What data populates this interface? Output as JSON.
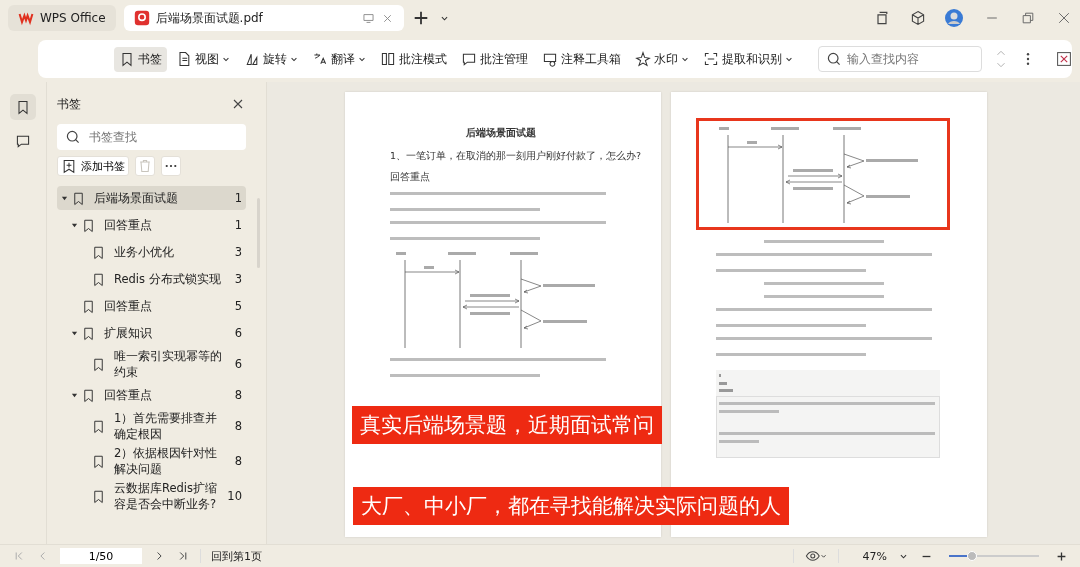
{
  "tabs": [
    {
      "label": "WPS Office",
      "selected": false
    },
    {
      "label": "后端场景面试题.pdf",
      "selected": true
    }
  ],
  "toolbar": {
    "buttons": [
      {
        "label": "书签",
        "selected": true,
        "dropdown": false
      },
      {
        "label": "视图",
        "selected": false,
        "dropdown": true
      },
      {
        "label": "旋转",
        "selected": false,
        "dropdown": true
      },
      {
        "label": "翻译",
        "selected": false,
        "dropdown": true
      },
      {
        "label": "批注模式",
        "selected": false,
        "dropdown": false
      },
      {
        "label": "批注管理",
        "selected": false,
        "dropdown": false
      },
      {
        "label": "注释工具箱",
        "selected": false,
        "dropdown": false
      },
      {
        "label": "水印",
        "selected": false,
        "dropdown": true
      },
      {
        "label": "提取和识别",
        "selected": false,
        "dropdown": true
      }
    ],
    "search": {
      "placeholder": "输入查找内容"
    }
  },
  "rail": [
    {
      "selected": true
    },
    {
      "selected": false
    }
  ],
  "bookmarks": {
    "title": "书签",
    "search": {
      "placeholder": "书签查找"
    },
    "add_button": "添加书签",
    "delete_disabled": true,
    "items": [
      {
        "label": "后端场景面试题",
        "page": "1",
        "selected": true,
        "expanded": true,
        "children": [
          {
            "label": "回答重点",
            "page": "1",
            "selected": false,
            "expanded": true,
            "children": [
              {
                "label": "业务小优化",
                "page": "3",
                "selected": false
              },
              {
                "label": "Redis 分布式锁实现",
                "page": "3",
                "selected": false
              }
            ]
          },
          {
            "label": "回答重点",
            "page": "5",
            "selected": false
          },
          {
            "label": "扩展知识",
            "page": "6",
            "selected": false,
            "expanded": true,
            "children": [
              {
                "label": "唯一索引实现幂等的约束",
                "page": "6",
                "selected": false
              }
            ]
          },
          {
            "label": "回答重点",
            "page": "8",
            "selected": false,
            "expanded": true,
            "children": [
              {
                "label": "1）首先需要排查并确定根因",
                "page": "8",
                "selected": false
              },
              {
                "label": "2）依据根因针对性解决问题",
                "page": "8",
                "selected": false
              },
              {
                "label": "云数据库Redis扩缩容是否会中断业务?",
                "page": "10",
                "selected": false
              }
            ]
          }
        ]
      }
    ]
  },
  "pages": [
    {
      "blocks": [
        {
          "kind": "title",
          "text": "后端场景面试题"
        },
        {
          "kind": "question",
          "text": "1、一笔订单，在取消的那一刻用户刚好付款了，怎么办?"
        },
        {
          "kind": "heading",
          "text": "回答重点"
        },
        {
          "kind": "paragraph"
        },
        {
          "kind": "paragraph"
        },
        {
          "kind": "diagram",
          "highlighted": false
        },
        {
          "kind": "paragraph"
        }
      ]
    },
    {
      "blocks": [
        {
          "kind": "diagram",
          "highlighted": true
        },
        {
          "kind": "line"
        },
        {
          "kind": "paragraph"
        },
        {
          "kind": "line"
        },
        {
          "kind": "line"
        },
        {
          "kind": "paragraph"
        },
        {
          "kind": "paragraph"
        },
        {
          "kind": "code"
        }
      ]
    }
  ],
  "banners": [
    "真实后端场景题，近期面试常问",
    "大厂、中小厂，都在寻找能解决实际问题的人"
  ],
  "status_bar": {
    "page": "1/50",
    "back_to_first": "回到第1页",
    "zoom": "47%",
    "zoom_slider": {
      "level": 0.25
    }
  }
}
